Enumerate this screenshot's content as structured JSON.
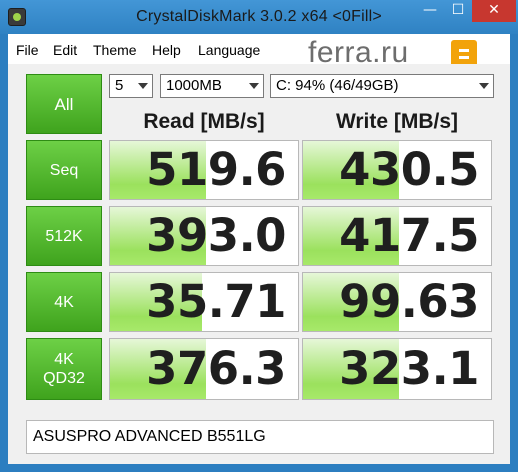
{
  "window": {
    "title": "CrystalDiskMark 3.0.2 x64 <0Fill>",
    "minimize_glyph": "—",
    "maximize_glyph": "☐",
    "close_glyph": "✕"
  },
  "menu": {
    "items": [
      "File",
      "Edit",
      "Theme",
      "Help",
      "Language"
    ]
  },
  "watermark": {
    "text": "ferra.ru",
    "badge_icon": "ferra-logo-icon",
    "badge_color": "#f2a30b"
  },
  "controls": {
    "all_button": "All",
    "test_count": "5",
    "test_size": "1000MB",
    "drive": "C: 94% (46/49GB)"
  },
  "headers": {
    "read": "Read [MB/s]",
    "write": "Write [MB/s]"
  },
  "tests": [
    {
      "label": "Seq",
      "read": "519.6",
      "write": "430.5",
      "read_fill": 0.51,
      "write_fill": 0.51
    },
    {
      "label": "512K",
      "read": "393.0",
      "write": "417.5",
      "read_fill": 0.51,
      "write_fill": 0.51
    },
    {
      "label": "4K",
      "read": "35.71",
      "write": "99.63",
      "read_fill": 0.49,
      "write_fill": 0.51
    },
    {
      "label_line1": "4K",
      "label_line2": "QD32",
      "read": "376.3",
      "write": "323.1",
      "read_fill": 0.51,
      "write_fill": 0.51
    }
  ],
  "comment": "ASUSPRO ADVANCED B551LG",
  "colors": {
    "titlebar": "#2f82c3",
    "close_button": "#c7372f",
    "button_green": "#4cb52a",
    "bar_green": "#9be15d"
  }
}
